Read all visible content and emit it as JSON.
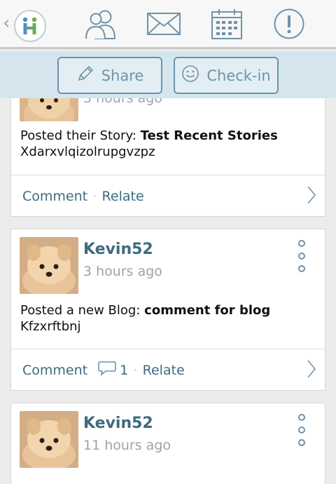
{
  "topbar": {
    "icons": [
      "back-chevron-icon",
      "app-logo-icon",
      "people-icon",
      "mail-icon",
      "calendar-icon",
      "alert-icon"
    ]
  },
  "actionbar": {
    "share_label": "Share",
    "checkin_label": "Check-in"
  },
  "feed": [
    {
      "time": "3 hours ago",
      "action": "Posted their Story:",
      "title": "Test Recent Stories",
      "excerpt": "Xdarxvlqizolrupgvzpz",
      "comment_label": "Comment",
      "relate_label": "Relate"
    },
    {
      "user": "Kevin52",
      "time": "3 hours ago",
      "action": "Posted a new Blog:",
      "title": "comment for blog",
      "excerpt": "Kfzxrftbnj",
      "comment_label": "Comment",
      "comment_count": "1",
      "relate_label": "Relate"
    },
    {
      "user": "Kevin52",
      "time": "11 hours ago"
    }
  ],
  "colors": {
    "accent": "#6f93a8",
    "link": "#3d6b7f",
    "actionbar_bg": "#d4e5ee",
    "logo_blue": "#4a8fc9",
    "logo_green": "#6ab04c"
  }
}
